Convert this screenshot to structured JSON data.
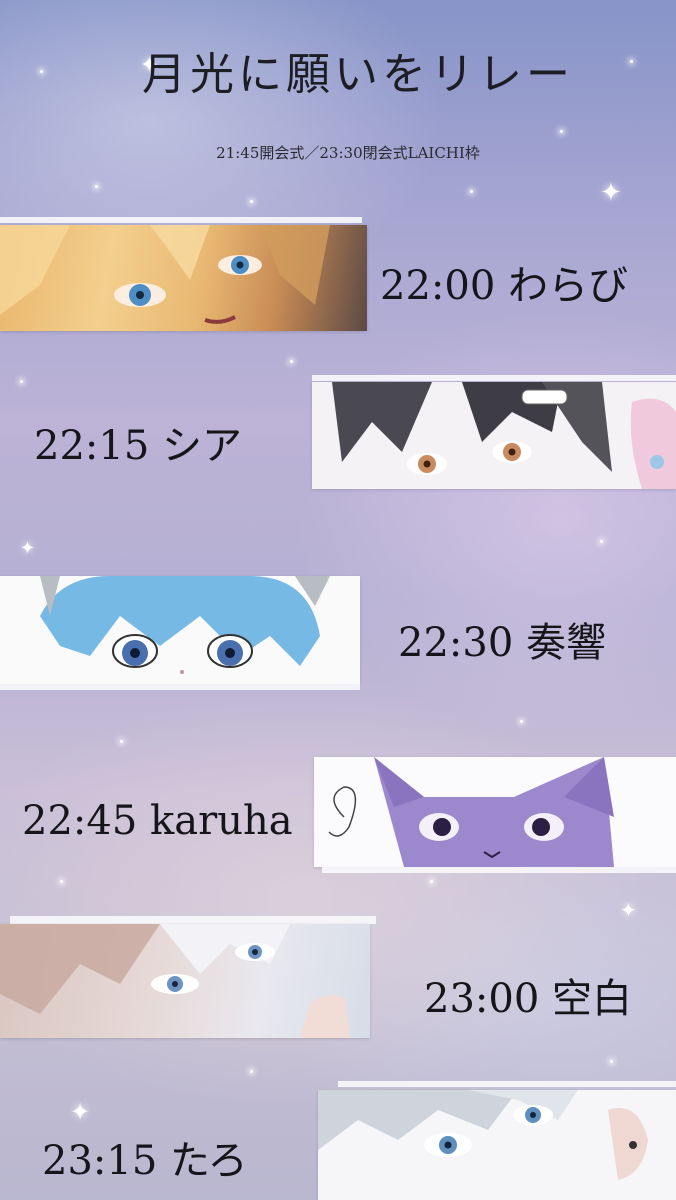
{
  "title": "月光に願いをリレー",
  "subtitle": "21:45開会式／23:30閉会式LAICHI枠",
  "schedule": [
    {
      "label": "22:00 わらび"
    },
    {
      "label": "22:15 シア"
    },
    {
      "label": "22:30 奏響"
    },
    {
      "label": "22:45 karuha"
    },
    {
      "label": "23:00 空白"
    },
    {
      "label": "23:15 たろ"
    }
  ]
}
